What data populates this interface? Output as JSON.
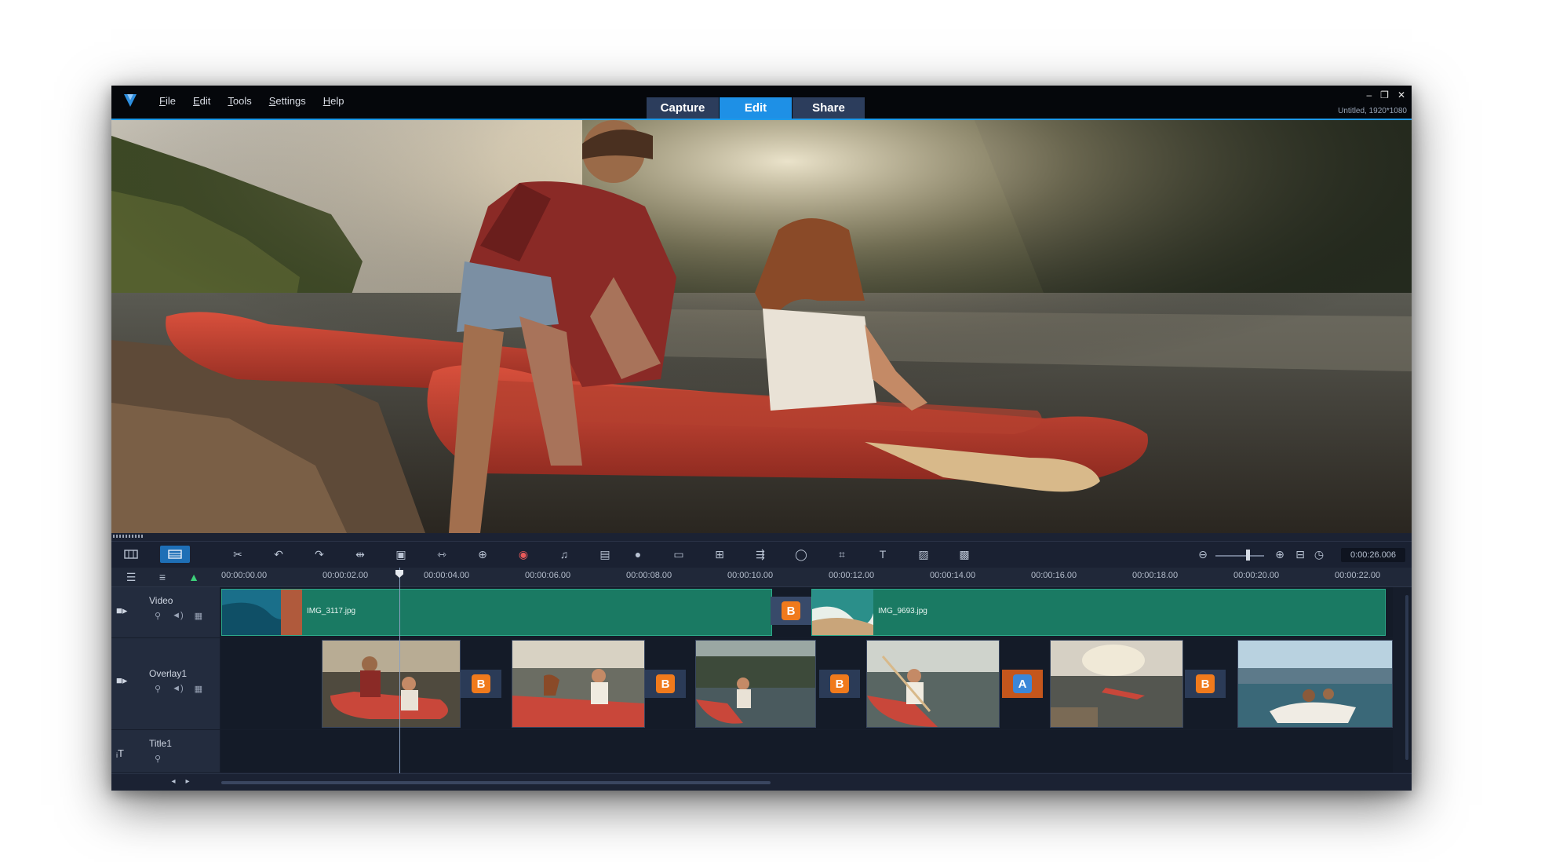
{
  "menu": {
    "items": [
      {
        "label": "File",
        "u": "F",
        "rest": "ile"
      },
      {
        "label": "Edit",
        "u": "E",
        "rest": "dit"
      },
      {
        "label": "Tools",
        "u": "T",
        "rest": "ools"
      },
      {
        "label": "Settings",
        "u": "S",
        "rest": "ettings"
      },
      {
        "label": "Help",
        "u": "H",
        "rest": "elp"
      }
    ]
  },
  "tabs": [
    {
      "label": "Capture",
      "active": false
    },
    {
      "label": "Edit",
      "active": true
    },
    {
      "label": "Share",
      "active": false
    }
  ],
  "window": {
    "minimize": "–",
    "restore": "❐",
    "close": "✕",
    "project_info": "Untitled, 1920*1080"
  },
  "toolbar": {
    "timecode": "0:00:26.006",
    "icons": [
      "storyboard-view-icon",
      "timeline-view-icon",
      "tools-icon",
      "undo-icon",
      "redo-icon",
      "trim-icon",
      "crop-icon",
      "split-icon",
      "multi-trim-icon",
      "color-icon",
      "audio-icon",
      "record-icon",
      "mask-icon",
      "title-icon",
      "split-screen-icon",
      "motion-tracking-icon",
      "loop-icon",
      "fit-icon",
      "3d-title-icon",
      "effect-icon",
      "screen-icon"
    ],
    "zoom_out": "zoom-out-icon",
    "zoom_in": "zoom-in-icon"
  },
  "ruler": {
    "labels": [
      "00:00:00.00",
      "00:00:02.00",
      "00:00:04.00",
      "00:00:06.00",
      "00:00:08.00",
      "00:00:10.00",
      "00:00:12.00",
      "00:00:14.00",
      "00:00:16.00",
      "00:00:18.00",
      "00:00:20.00",
      "00:00:22.00"
    ]
  },
  "tracks": {
    "video": {
      "name": "Video",
      "clip1": "IMG_3117.jpg",
      "clip2": "IMG_9693.jpg"
    },
    "overlay": {
      "name": "Overlay1"
    },
    "title": {
      "name": "Title1"
    }
  },
  "colors": {
    "accent": "#1e90e6",
    "clip_green": "#1a7a63",
    "transition_orange": "#f07a1c",
    "background": "#1b2233"
  }
}
